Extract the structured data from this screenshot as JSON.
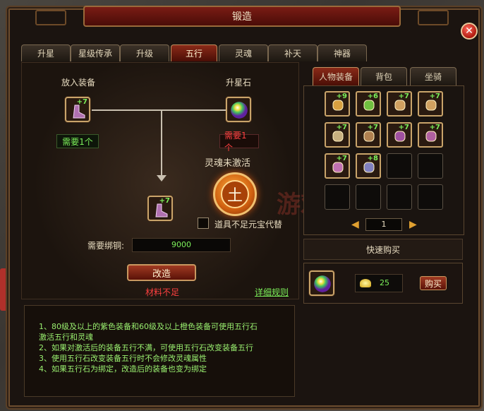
{
  "window": {
    "title": "锻造"
  },
  "tabs": [
    {
      "label": "升星"
    },
    {
      "label": "星级传承"
    },
    {
      "label": "升级"
    },
    {
      "label": "五行"
    },
    {
      "label": "灵魂"
    },
    {
      "label": "补天"
    },
    {
      "label": "神器"
    }
  ],
  "active_tab": "五行",
  "left": {
    "put_equip_label": "放入装备",
    "star_stone_label": "升星石",
    "equip_plus": "+7",
    "need_equip": "需要1个",
    "need_stone": "需要1个",
    "soul_status": "灵魂未激活",
    "element_char": "土",
    "result_plus": "+7",
    "substitute_label": "道具不足元宝代替",
    "copper_label": "需要绑铜:",
    "copper_value": "9000",
    "forge_button": "改造",
    "insufficient": "材料不足",
    "rules_link": "详细规则",
    "watermark": "游戏"
  },
  "help": {
    "lines": [
      "1、80级及以上的紫色装备和60级及以上橙色装备可使用五行石",
      "激活五行和灵魂",
      "2、如果对激活后的装备五行不满，可使用五行石改变装备五行",
      "3、使用五行石改变装备五行时不会修改灵魂属性",
      "4、如果五行石为绑定，改造后的装备也变为绑定"
    ]
  },
  "right": {
    "tabs": [
      {
        "label": "人物装备"
      },
      {
        "label": "背包"
      },
      {
        "label": "坐骑"
      }
    ],
    "active_tab": "人物装备",
    "items": [
      {
        "plus": "+9",
        "icon": "weapon-icon",
        "color": "#d8a040"
      },
      {
        "plus": "+6",
        "icon": "necklace-icon",
        "color": "#70c040"
      },
      {
        "plus": "+7",
        "icon": "ring-icon",
        "color": "#d0a060"
      },
      {
        "plus": "+7",
        "icon": "ring-icon",
        "color": "#d0a060"
      },
      {
        "plus": "+7",
        "icon": "helmet-icon",
        "color": "#c8b080"
      },
      {
        "plus": "+7",
        "icon": "armor-icon",
        "color": "#b08050"
      },
      {
        "plus": "+7",
        "icon": "gloves-icon",
        "color": "#a050a0"
      },
      {
        "plus": "+7",
        "icon": "boots-icon",
        "color": "#b060a0"
      },
      {
        "plus": "+7",
        "icon": "boots-icon",
        "color": "#c070b0"
      },
      {
        "plus": "+8",
        "icon": "belt-icon",
        "color": "#8080c0"
      }
    ],
    "page": "1",
    "quick_buy": "快速购买",
    "price": "25",
    "buy_button": "购买"
  }
}
